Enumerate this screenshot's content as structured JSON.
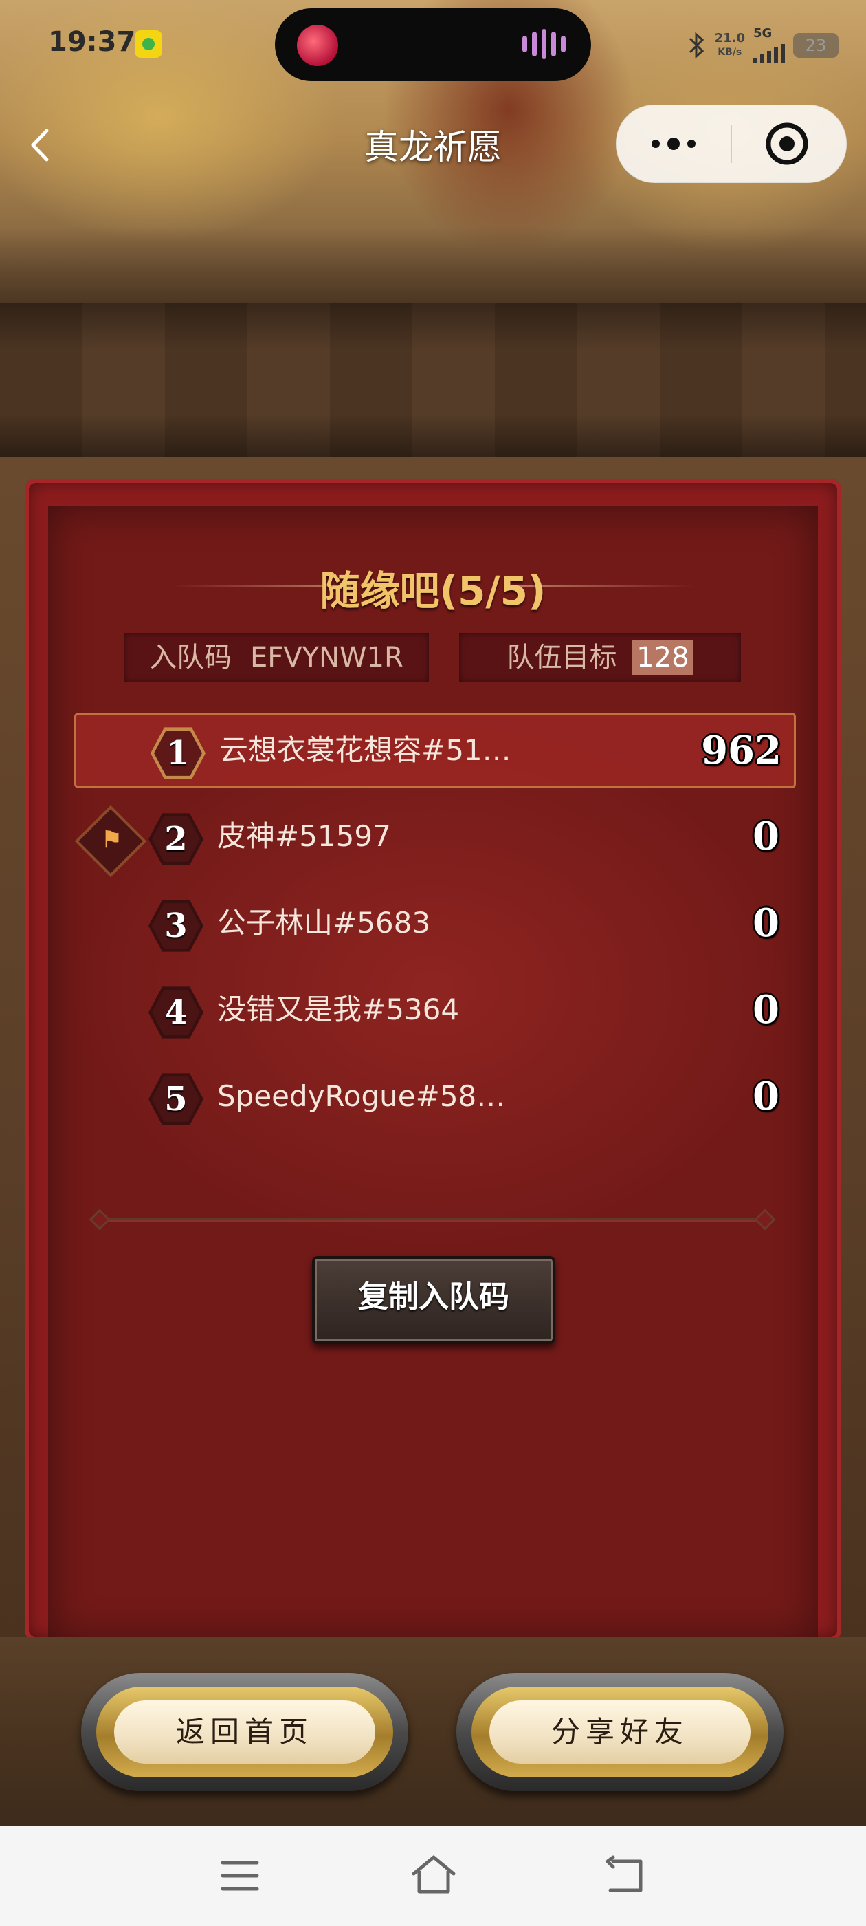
{
  "status_bar": {
    "time": "19:37",
    "net_speed": "21.0",
    "net_unit": "KB/s",
    "network": "5G",
    "battery": "23"
  },
  "nav": {
    "title": "真龙祈愿"
  },
  "team": {
    "name": "随缘吧(5/5)",
    "invite_label": "入队码",
    "invite_code": "EFVYNW1R",
    "goal_label": "队伍目标",
    "goal_value": "128"
  },
  "members": [
    {
      "rank": "1",
      "name": "云想衣裳花想容#51…",
      "score": "962"
    },
    {
      "rank": "2",
      "name": "皮神#51597",
      "score": "0"
    },
    {
      "rank": "3",
      "name": "公子林山#5683",
      "score": "0"
    },
    {
      "rank": "4",
      "name": "没错又是我#5364",
      "score": "0"
    },
    {
      "rank": "5",
      "name": "SpeedyRogue#58…",
      "score": "0"
    }
  ],
  "buttons": {
    "copy_code": "复制入队码",
    "home": "返回首页",
    "share": "分享好友"
  },
  "colors": {
    "panel_red": "#8d1c1e",
    "title_gold": "#f2c46a",
    "button_gold": "#d2ab4d"
  },
  "icons": [
    "back-chevron-icon",
    "more-dots-icon",
    "close-target-icon",
    "flag-icon",
    "menu-icon",
    "home-icon",
    "back-icon"
  ]
}
